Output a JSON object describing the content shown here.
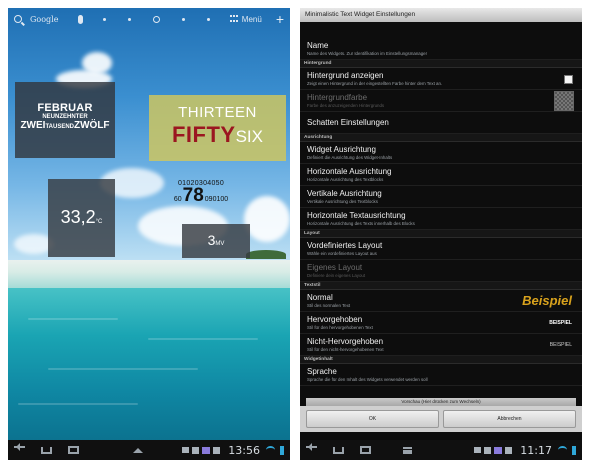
{
  "left": {
    "topbar": {
      "search_label": "Google",
      "menu_label": "Menü"
    },
    "date_widget": {
      "month": "FEBRUAR",
      "day": "NEUNZEHNTER",
      "year_a": "ZWEI",
      "year_b": "TAUSEND",
      "year_c": "ZWÖLF"
    },
    "time_widget": {
      "hour": "THIRTEEN",
      "minute_big": "FIFTY",
      "minute_small": "SIX"
    },
    "seconds_widget": {
      "top": "01020304050",
      "left": "60",
      "center": "78",
      "right": "090100"
    },
    "battery_widget": {
      "value": "33,2",
      "unit": "°C"
    },
    "volt_widget": {
      "value": "3",
      "unit": "MV"
    },
    "navbar": {
      "clock": "13:56"
    }
  },
  "right": {
    "title": "Minimalistic Text Widget Einstellungen",
    "items": [
      {
        "type": "pref",
        "title": "Name",
        "summary": "Name des Widgets. Zur Identifikation im Einstellungsmanager"
      },
      {
        "type": "cat",
        "title": "Hintergrund"
      },
      {
        "type": "pref",
        "title": "Hintergrund anzeigen",
        "summary": "Zeigt einen Hintergrund in der eingestellten Farbe hinter dem Text an."
      },
      {
        "type": "pref",
        "title": "Hintergrundfarbe",
        "summary": "Farbe des anzuzeigenden Hintergrunds"
      },
      {
        "type": "pref",
        "title": "Schatten Einstellungen",
        "summary": ""
      },
      {
        "type": "cat",
        "title": "Ausrichtung"
      },
      {
        "type": "pref",
        "title": "Widget Ausrichtung",
        "summary": "Definiert die Ausrichtung des Widget-Inhalts"
      },
      {
        "type": "pref",
        "title": "Horizontale Ausrichtung",
        "summary": "Horizontale Ausrichtung des Textblocks"
      },
      {
        "type": "pref",
        "title": "Vertikale Ausrichtung",
        "summary": "Vertikale Ausrichtung des Textblocks"
      },
      {
        "type": "pref",
        "title": "Horizontale Textausrichtung",
        "summary": "Horizontale Ausrichtung des Texts innerhalb des Blocks"
      },
      {
        "type": "cat",
        "title": "Layout"
      },
      {
        "type": "pref",
        "title": "Vordefiniertes Layout",
        "summary": "Wähle ein vordefiniertes Layout aus"
      },
      {
        "type": "pref",
        "title": "Eigenes Layout",
        "summary": "Definiere dein eigenes Layout"
      },
      {
        "type": "cat",
        "title": "Textstil"
      },
      {
        "type": "pref",
        "title": "Normal",
        "summary": "Stil des normalen Text",
        "sample": "Beispiel"
      },
      {
        "type": "pref",
        "title": "Hervorgehoben",
        "summary": "Stil für den hervorgehobenen Text",
        "sample": "BEISPIEL"
      },
      {
        "type": "pref",
        "title": "Nicht-Hervorgehoben",
        "summary": "Stil für den nicht-hervorgehobenen Text",
        "sample": "BEISPIEL"
      },
      {
        "type": "cat",
        "title": "Widgetinhalt"
      },
      {
        "type": "pref",
        "title": "Sprache",
        "summary": "Sprache die für den Inhalt des Widgets verwendet werden soll"
      }
    ],
    "preview": "Vorschau (Hier drücken zum Wechseln)",
    "ok": "OK",
    "cancel": "Abbrechen",
    "navbar": {
      "clock": "11:17"
    }
  }
}
